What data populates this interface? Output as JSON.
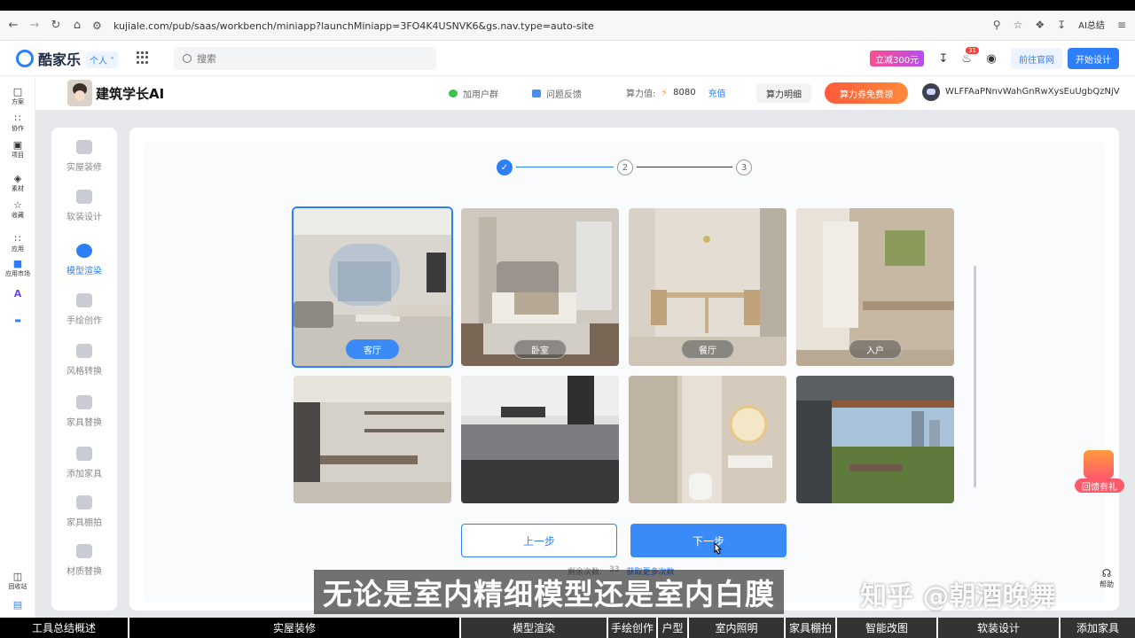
{
  "browser": {
    "url": "kujiale.com/pub/saas/workbench/miniapp?launchMiniapp=3FO4K4USNVK6&gs.nav.type=auto-site",
    "ai_label": "AI总结"
  },
  "header": {
    "logo_text": "酷家乐",
    "account_type": "个人",
    "search_placeholder": "搜索",
    "promo_label": "立减300元",
    "notification_count": "31",
    "official_site_label": "前往官网",
    "start_design_label": "开始设计"
  },
  "rail": {
    "items": [
      {
        "label": "方案",
        "icon": "file-icon"
      },
      {
        "label": "协作",
        "icon": "people-icon"
      },
      {
        "label": "项目",
        "icon": "folder-icon"
      },
      {
        "label": "素材",
        "icon": "cube-icon"
      },
      {
        "label": "收藏",
        "icon": "star-icon"
      },
      {
        "label": "应用",
        "icon": "apps-icon"
      },
      {
        "label": "应用市场",
        "icon": "market-icon"
      }
    ],
    "recycle_label": "回收站"
  },
  "miniapp": {
    "title": "建筑学长AI",
    "join_group": "加用户群",
    "feedback": "问题反馈",
    "points_label": "算力值:",
    "points_value": "8080",
    "recharge": "充值",
    "points_detail": "算力明细",
    "coupon": "算力券免费领",
    "username": "WLFFAaPNnvWahGnRwXysEuUgbQzNjV"
  },
  "features": [
    {
      "label": "实屋装修",
      "active": false
    },
    {
      "label": "软装设计",
      "active": false
    },
    {
      "label": "模型渲染",
      "active": true
    },
    {
      "label": "手绘创作",
      "active": false
    },
    {
      "label": "风格转换",
      "active": false
    },
    {
      "label": "家具替换",
      "active": false
    },
    {
      "label": "添加家具",
      "active": false
    },
    {
      "label": "家具棚拍",
      "active": false
    },
    {
      "label": "材质替换",
      "active": false
    }
  ],
  "stepper": {
    "steps": [
      "✓",
      "2",
      "3"
    ],
    "current": 1
  },
  "rooms": [
    {
      "label": "客厅",
      "selected": true
    },
    {
      "label": "卧室",
      "selected": false
    },
    {
      "label": "餐厅",
      "selected": false
    },
    {
      "label": "入户",
      "selected": false
    },
    {
      "label": "",
      "selected": false
    },
    {
      "label": "",
      "selected": false
    },
    {
      "label": "",
      "selected": false
    },
    {
      "label": "",
      "selected": false
    }
  ],
  "actions": {
    "prev": "上一步",
    "next": "下一步",
    "remaining_label": "剩余次数:",
    "remaining_value": "33",
    "get_more": "获取更多次数"
  },
  "floating": {
    "gift_label": "回馈有礼",
    "help_label": "帮助"
  },
  "overlay": {
    "subtitle": "无论是室内精细模型还是室内白膜",
    "watermark": "知乎 @朝酒晚舞"
  },
  "chapters": [
    {
      "label": "工具总结概述",
      "current": false
    },
    {
      "label": "实屋装修",
      "current": false
    },
    {
      "label": "模型渲染",
      "current": true
    },
    {
      "label": "手绘创作",
      "current": false
    },
    {
      "label": "户型",
      "current": false
    },
    {
      "label": "室内照明",
      "current": false
    },
    {
      "label": "家具棚拍",
      "current": false
    },
    {
      "label": "智能改图",
      "current": false
    },
    {
      "label": "软装设计",
      "current": false
    },
    {
      "label": "添加家具",
      "current": false
    }
  ],
  "colors": {
    "accent": "#2d7ff9",
    "coupon": "#ff5b3a",
    "promo": "#e84cb8"
  }
}
